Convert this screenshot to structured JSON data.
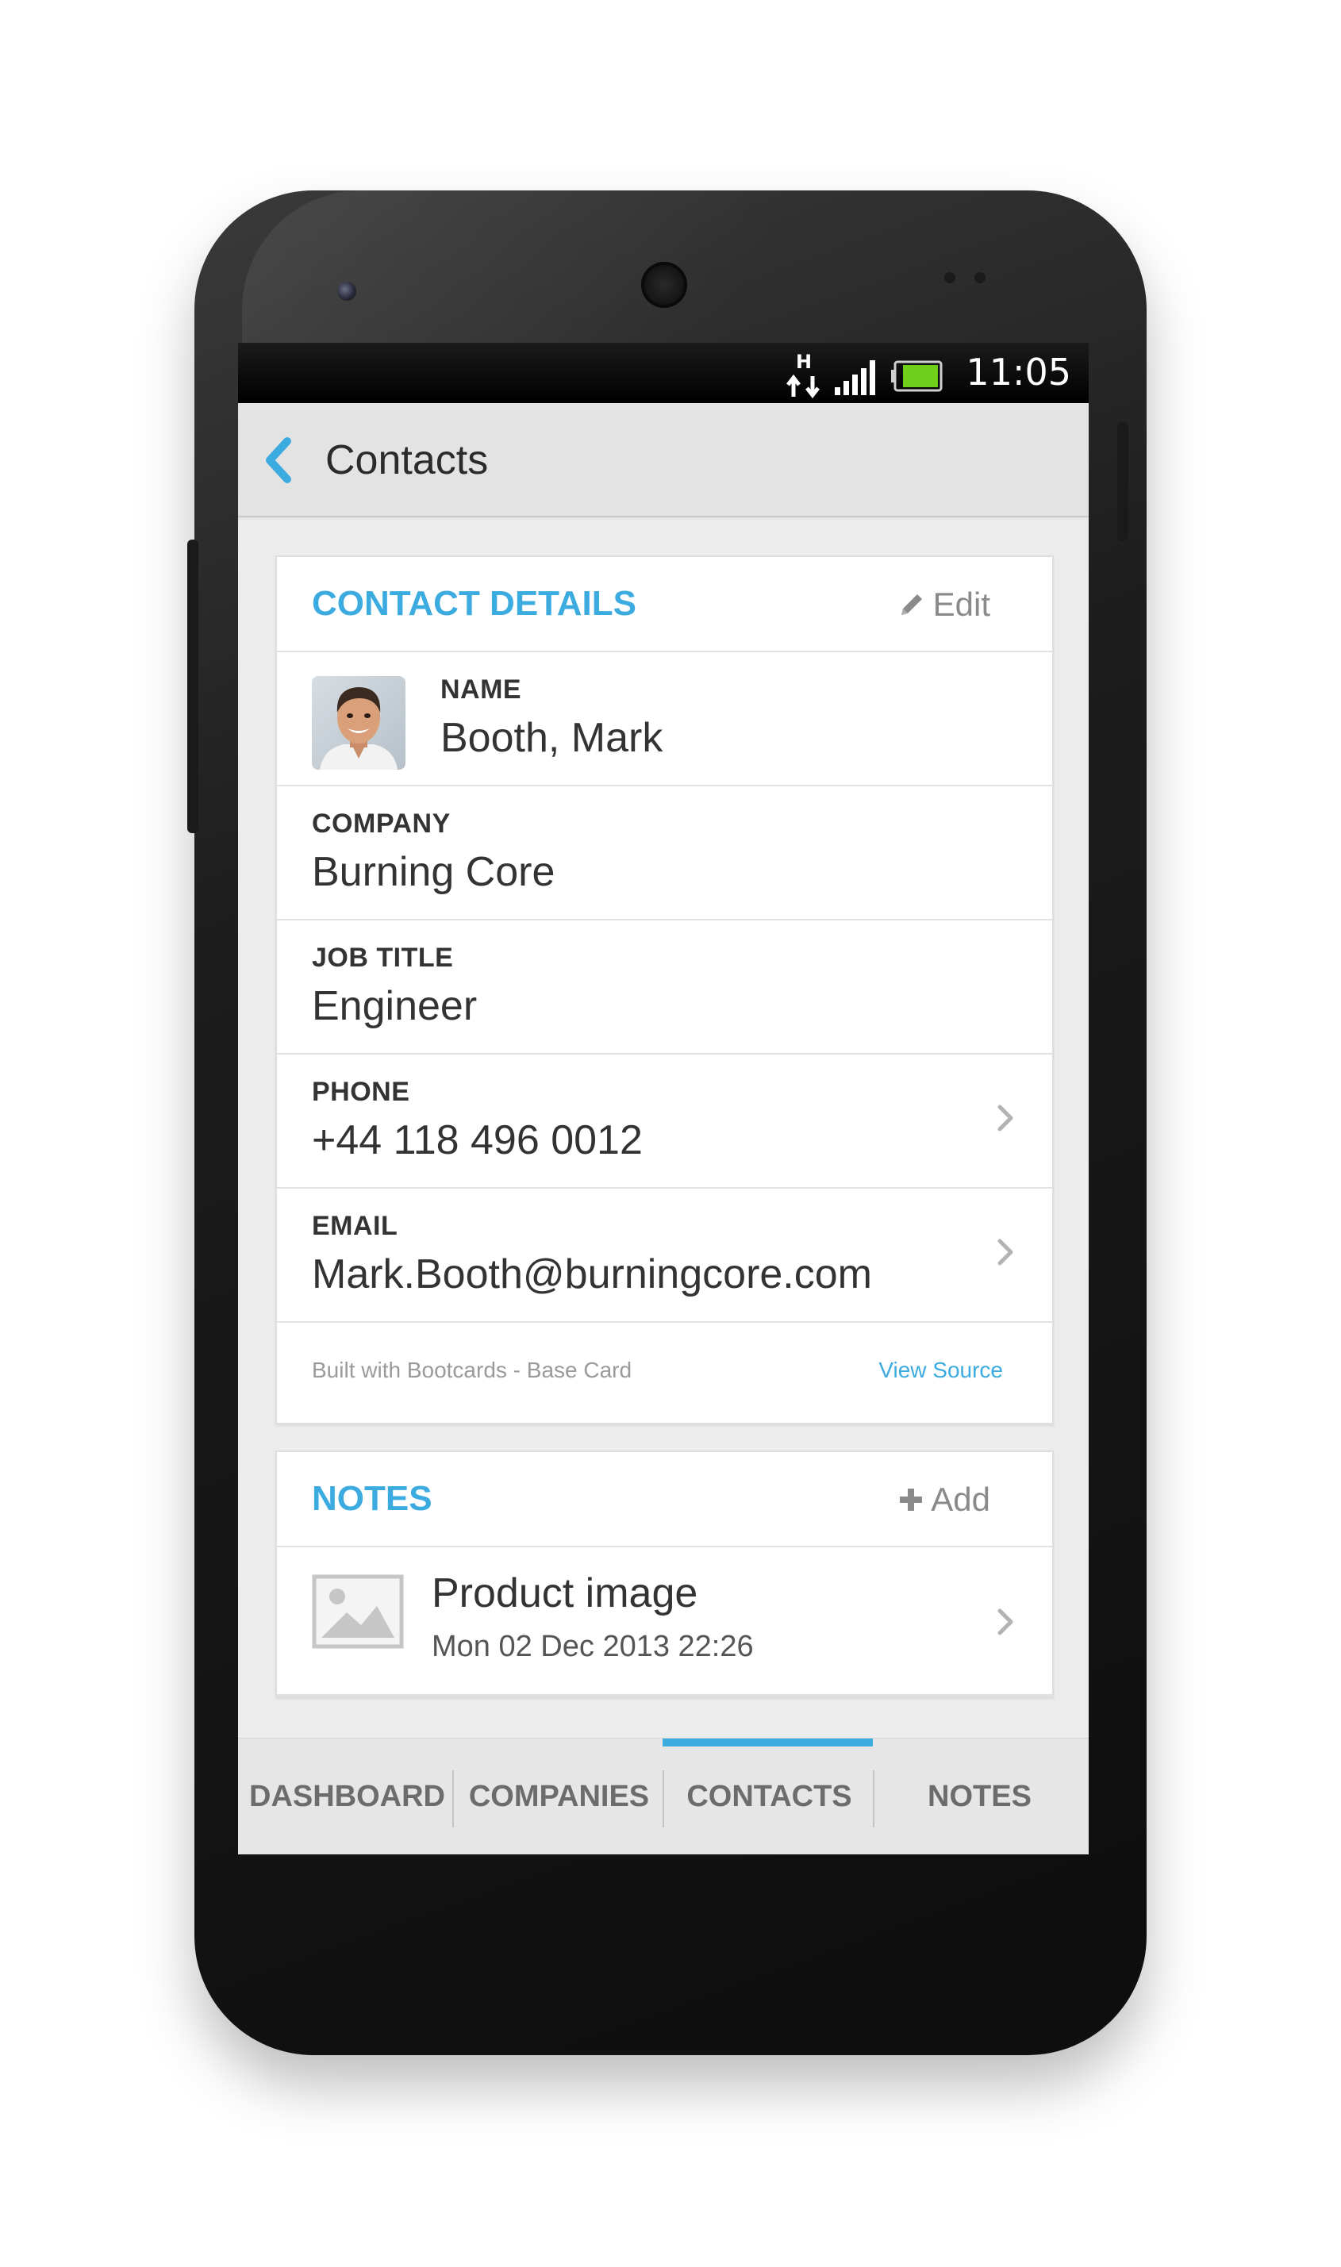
{
  "status_bar": {
    "network_label": "H",
    "time": "11:05"
  },
  "app_bar": {
    "title": "Contacts",
    "back_icon": "chevron-left-icon"
  },
  "contact_card": {
    "heading": "CONTACT DETAILS",
    "edit_label": "Edit",
    "name": {
      "label": "NAME",
      "value": "Booth, Mark"
    },
    "company": {
      "label": "COMPANY",
      "value": "Burning Core"
    },
    "job_title": {
      "label": "JOB TITLE",
      "value": "Engineer"
    },
    "phone": {
      "label": "PHONE",
      "value": "+44 118 496 0012"
    },
    "email": {
      "label": "EMAIL",
      "value": "Mark.Booth@burningcore.com"
    },
    "footer_text": "Built with Bootcards - Base Card",
    "footer_link": "View Source"
  },
  "notes_card": {
    "heading": "NOTES",
    "add_label": "Add",
    "items": [
      {
        "title": "Product image",
        "date": "Mon 02 Dec 2013 22:26"
      }
    ]
  },
  "bottom_nav": {
    "tabs": [
      "DASHBOARD",
      "COMPANIES",
      "CONTACTS",
      "NOTES"
    ],
    "active": "CONTACTS"
  },
  "colors": {
    "accent": "#3cabe0",
    "text": "#333333",
    "muted": "#8a8a8a",
    "phone_body": "#1c1c1c"
  }
}
